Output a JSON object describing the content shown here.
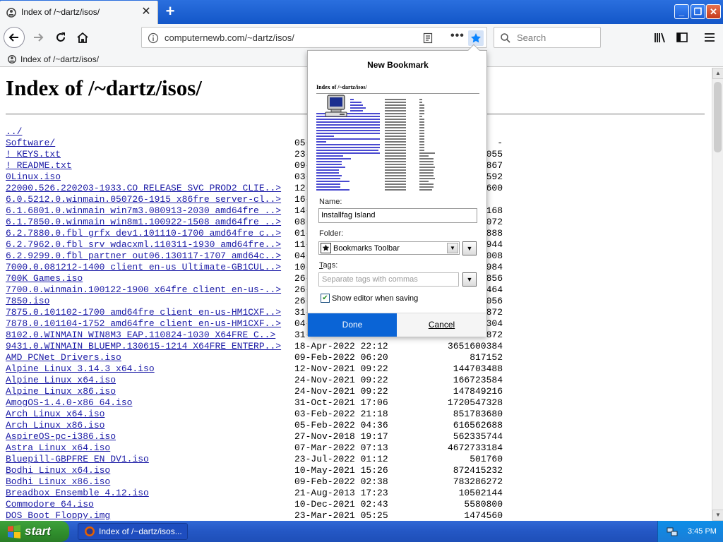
{
  "tab": {
    "title": "Index of /~dartz/isos/",
    "close_icon": "close-icon"
  },
  "toolbar": {
    "url": "computernewb.com/~dartz/isos/",
    "search_placeholder": "Search"
  },
  "bookmarks_toolbar": {
    "item": "Index of /~dartz/isos/"
  },
  "page": {
    "heading": "Index of /~dartz/isos/",
    "entries": [
      {
        "name": "../",
        "date": "",
        "size": ""
      },
      {
        "name": "Software/",
        "date": "05-",
        "size": "-"
      },
      {
        "name": "! KEYS.txt",
        "date": "23-",
        "size": "055"
      },
      {
        "name": "! README.txt",
        "date": "09-",
        "size": "867"
      },
      {
        "name": "0Linux.iso",
        "date": "03-",
        "size": "592"
      },
      {
        "name": "22000.526.220203-1933.CO RELEASE SVC PROD2 CLIE..>",
        "date": "12-",
        "size": "600"
      },
      {
        "name": "6.0.5212.0.winmain.050726-1915 x86fre server-cl..>",
        "date": "16-",
        "size": ""
      },
      {
        "name": "6.1.6801.0.winmain win7m3.080913-2030 amd64fre ..>",
        "date": "14-",
        "size": "168"
      },
      {
        "name": "6.1.7850.0.winmain win8m1.100922-1508 amd64fre ..>",
        "date": "08-",
        "size": "072"
      },
      {
        "name": "6.2.7880.0.fbl grfx dev1.101110-1700 amd64fre c..>",
        "date": "01-",
        "size": "888"
      },
      {
        "name": "6.2.7962.0.fbl srv wdacxml.110311-1930 amd64fre..>",
        "date": "11-",
        "size": "944"
      },
      {
        "name": "6.2.9299.0.fbl partner out06.130117-1707 amd64c..>",
        "date": "04-",
        "size": "008"
      },
      {
        "name": "7000.0.081212-1400 client en-us Ultimate-GB1CUL..>",
        "date": "10-",
        "size": "984"
      },
      {
        "name": "700K Games.iso",
        "date": "26-",
        "size": "856"
      },
      {
        "name": "7700.0.winmain.100122-1900 x64fre client en-us-..>",
        "date": "26-",
        "size": "464"
      },
      {
        "name": "7850.iso",
        "date": "26-",
        "size": "056"
      },
      {
        "name": "7875.0.101102-1700 amd64fre client en-us-HM1CXF..>",
        "date": "31-",
        "size": "872"
      },
      {
        "name": "7878.0.101104-1752 amd64fre client en-us-HM1CXF..>",
        "date": "04-",
        "size": "304"
      },
      {
        "name": "8102.0.WINMAIN WIN8M3 EAP.110824-1030 X64FRE C..>",
        "date": "31-",
        "size": "872"
      },
      {
        "name": "9431.0.WINMAIN BLUEMP.130615-1214 X64FRE ENTERP..>",
        "date": "18-Apr-2022 22:12",
        "size": "3651600384"
      },
      {
        "name": "AMD PCNet Drivers.iso",
        "date": "09-Feb-2022 06:20",
        "size": "817152"
      },
      {
        "name": "Alpine Linux 3.14.3 x64.iso",
        "date": "12-Nov-2021 09:22",
        "size": "144703488"
      },
      {
        "name": "Alpine Linux x64.iso",
        "date": "24-Nov-2021 09:22",
        "size": "166723584"
      },
      {
        "name": "Alpine Linux x86.iso",
        "date": "24-Nov-2021 09:22",
        "size": "147849216"
      },
      {
        "name": "AmogOS-1.4.0-x86 64.iso",
        "date": "31-Oct-2021 17:06",
        "size": "1720547328"
      },
      {
        "name": "Arch Linux x64.iso",
        "date": "03-Feb-2022 21:18",
        "size": "851783680"
      },
      {
        "name": "Arch Linux x86.iso",
        "date": "05-Feb-2022 04:36",
        "size": "616562688"
      },
      {
        "name": "AspireOS-pc-i386.iso",
        "date": "27-Nov-2018 19:17",
        "size": "562335744"
      },
      {
        "name": "Astra Linux x64.iso",
        "date": "07-Mar-2022 07:13",
        "size": "4672733184"
      },
      {
        "name": "Bluepill-GBPFRE EN DV1.iso",
        "date": "23-Jul-2022 01:12",
        "size": "501760"
      },
      {
        "name": "Bodhi Linux x64.iso",
        "date": "10-May-2021 15:26",
        "size": "872415232"
      },
      {
        "name": "Bodhi Linux x86.iso",
        "date": "09-Feb-2022 02:38",
        "size": "783286272"
      },
      {
        "name": "Breadbox Ensemble 4.12.iso",
        "date": "21-Aug-2013 17:23",
        "size": "10502144"
      },
      {
        "name": "Commodore 64.iso",
        "date": "10-Dec-2021 02:43",
        "size": "5580800"
      },
      {
        "name": "DOS Boot Floppy.img",
        "date": "23-Mar-2021 05:25",
        "size": "1474560"
      }
    ]
  },
  "bookmark_panel": {
    "title": "New Bookmark",
    "preview_title": "Index of /~dartz/isos/",
    "name_label": "Name:",
    "name_value": "Installfag Island",
    "folder_label": "Folder:",
    "folder_value": "Bookmarks Toolbar",
    "tags_label": "Tags:",
    "tags_placeholder": "Separate tags with commas",
    "show_editor_label": "Show editor when saving",
    "show_editor_checked": true,
    "done_label": "Done",
    "cancel_label": "Cancel"
  },
  "taskbar": {
    "start_label": "start",
    "task_label": "Index of /~dartz/isos...",
    "clock": "3:45 PM"
  },
  "colors": {
    "link": "#1a1aa6",
    "done_button": "#0a64d6",
    "bookmark_star": "#0a84ff",
    "titlebar": "#1356c8"
  }
}
